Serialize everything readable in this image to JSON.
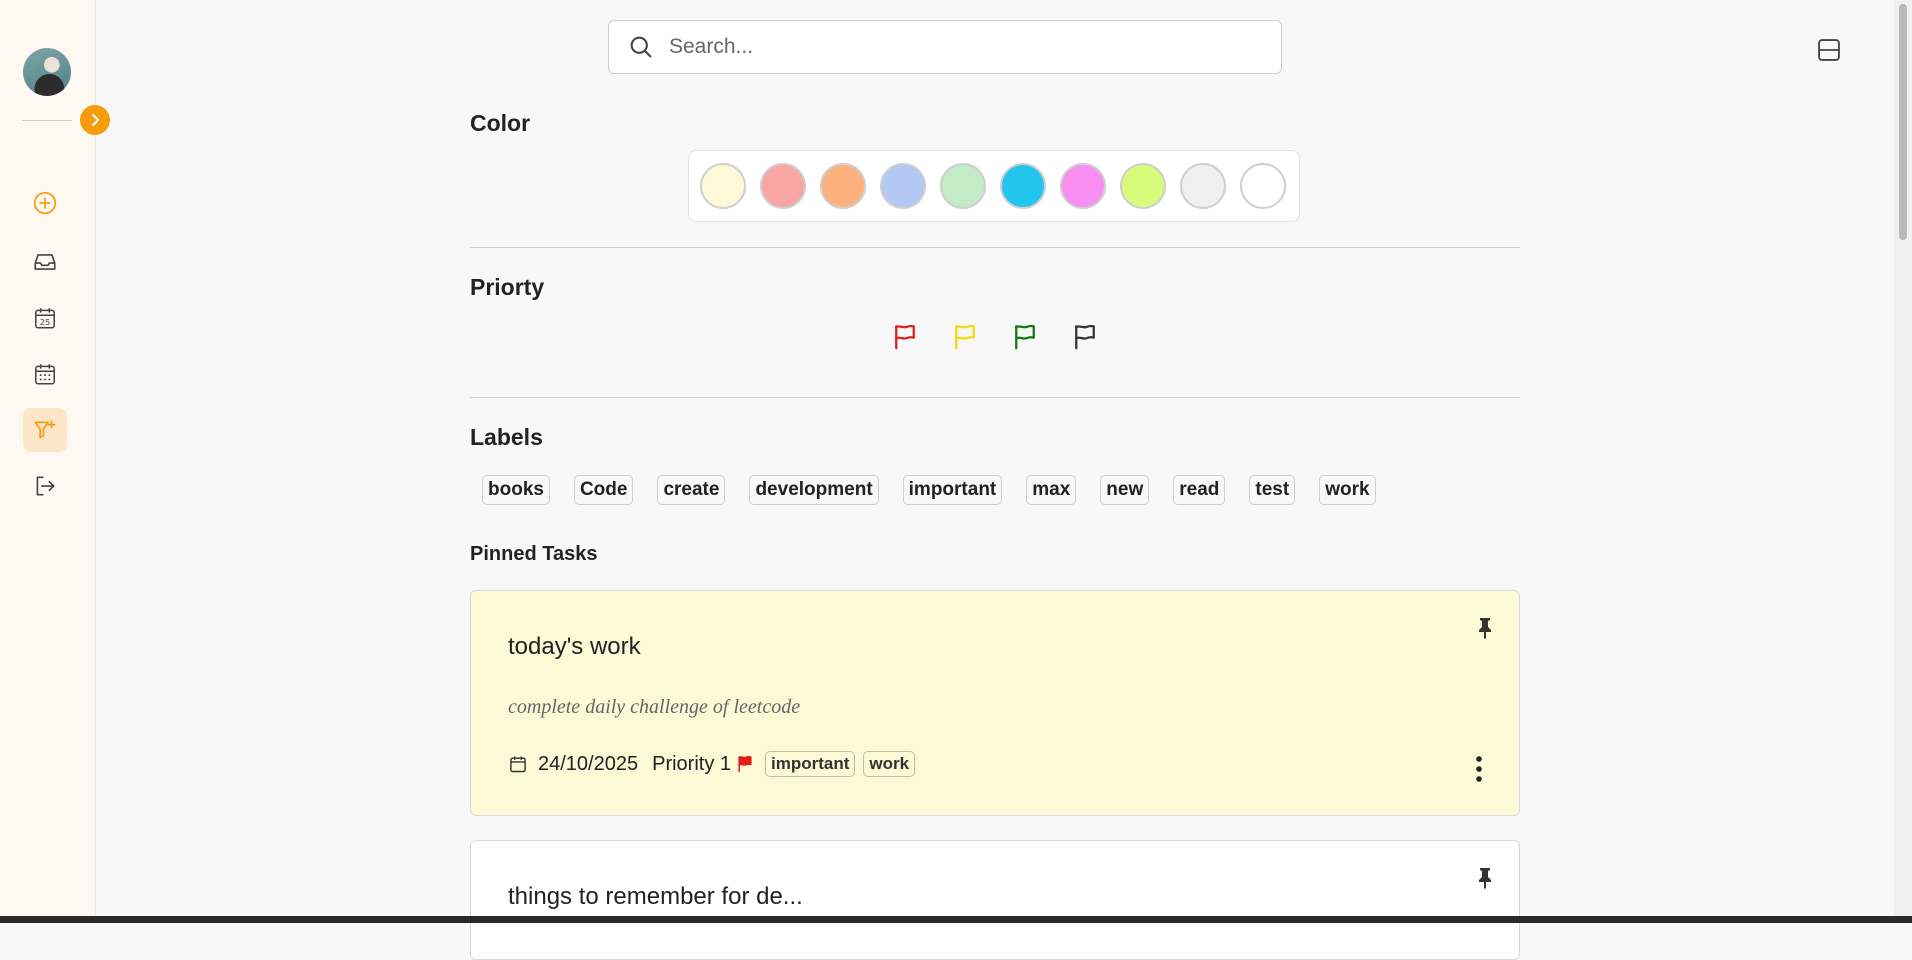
{
  "search": {
    "placeholder": "Search..."
  },
  "sections": {
    "color": "Color",
    "priority": "Priorty",
    "labels": "Labels",
    "pinned": "Pinned Tasks"
  },
  "colors": [
    "#fdf9d8",
    "#f8a6a4",
    "#fdb17c",
    "#b3c8f2",
    "#c2ebc6",
    "#22c5ee",
    "#f98ef2",
    "#d7fb7a",
    "#f0f0f0",
    "#ffffff"
  ],
  "priority_flags": [
    {
      "name": "Priority 1",
      "color": "#e11d1d"
    },
    {
      "name": "Priority 2",
      "color": "#f5d90a"
    },
    {
      "name": "Priority 3",
      "color": "#0f7a0f"
    },
    {
      "name": "Priority 4",
      "color": "#333333"
    }
  ],
  "labels": [
    "books",
    "Code",
    "create",
    "development",
    "important",
    "max",
    "new",
    "read",
    "test",
    "work"
  ],
  "tasks": [
    {
      "title": "today's work",
      "description": "complete daily challenge of leetcode",
      "date": "24/10/2025",
      "priority": "Priority 1",
      "priority_color": "#e11d1d",
      "labels": [
        "important",
        "work"
      ],
      "background": "#fcf9d6"
    },
    {
      "title": "things to remember for de...",
      "background": "#ffffff"
    }
  ],
  "sidebar": {
    "items": [
      "add-task",
      "inbox",
      "today",
      "upcoming",
      "filters",
      "logout"
    ],
    "accent": "#f59e0b"
  }
}
